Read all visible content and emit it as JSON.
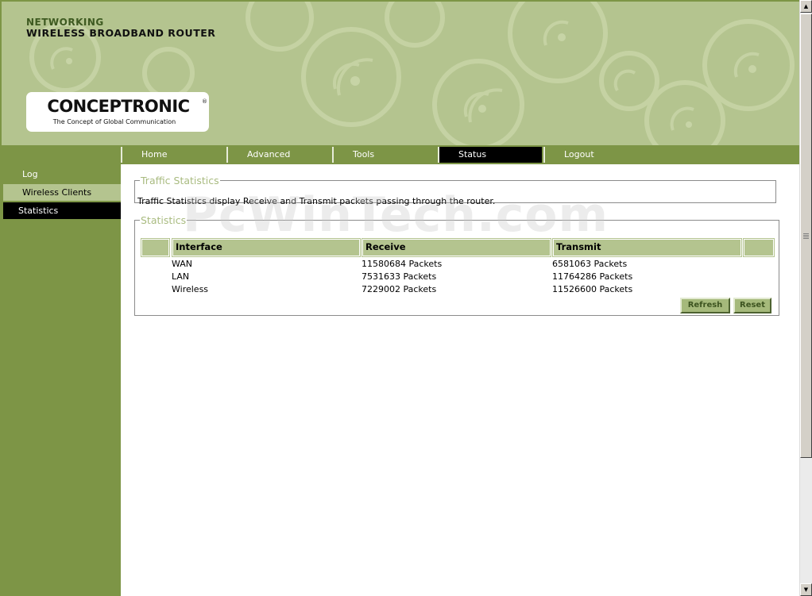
{
  "header": {
    "line1": "NETWORKING",
    "line2": "WIRELESS BROADBAND ROUTER",
    "logo_text": "CONCEPTRONIC",
    "logo_reg": "®",
    "logo_tagline": "The Concept of Global Communication"
  },
  "nav": {
    "tabs": [
      {
        "label": "Home"
      },
      {
        "label": "Advanced"
      },
      {
        "label": "Tools"
      },
      {
        "label": "Status",
        "active": true
      },
      {
        "label": "Logout"
      }
    ]
  },
  "sidebar": {
    "items": [
      {
        "label": "Log"
      },
      {
        "label": "Wireless Clients"
      },
      {
        "label": "Statistics",
        "active": true
      }
    ]
  },
  "traffic": {
    "legend": "Traffic Statistics",
    "description": "Traffic Statistics display Receive and Transmit packets passing through the router."
  },
  "statistics": {
    "legend": "Statistics",
    "columns": [
      "Interface",
      "Receive",
      "Transmit"
    ],
    "rows": [
      {
        "interface": "WAN",
        "receive": "11580684 Packets",
        "transmit": "6581063 Packets"
      },
      {
        "interface": "LAN",
        "receive": "7531633 Packets",
        "transmit": "11764286 Packets"
      },
      {
        "interface": "Wireless",
        "receive": "7229002 Packets",
        "transmit": "11526600 Packets"
      }
    ],
    "refresh_label": "Refresh",
    "reset_label": "Reset"
  },
  "watermark": "PcWinTech.com",
  "colors": {
    "banner": "#b4c48f",
    "nav_green": "#7d9546",
    "active_tab": "#000000",
    "legend_text": "#a9bb80",
    "button": "#a5b97b"
  }
}
